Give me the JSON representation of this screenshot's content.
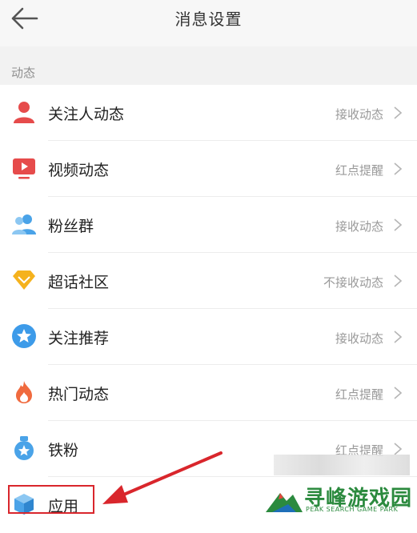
{
  "header": {
    "title": "消息设置",
    "back_icon": "back-arrow-icon"
  },
  "section": {
    "label": "动态"
  },
  "items": [
    {
      "label": "关注人动态",
      "value": "接收动态",
      "icon": "person-icon",
      "color": "#e64b4b"
    },
    {
      "label": "视频动态",
      "value": "红点提醒",
      "icon": "video-icon",
      "color": "#e64b4b"
    },
    {
      "label": "粉丝群",
      "value": "接收动态",
      "icon": "fans-group-icon",
      "color": "#4aa3e8"
    },
    {
      "label": "超话社区",
      "value": "不接收动态",
      "icon": "diamond-icon",
      "color": "#f5b21d"
    },
    {
      "label": "关注推荐",
      "value": "接收动态",
      "icon": "star-badge-icon",
      "color": "#3d9be9"
    },
    {
      "label": "热门动态",
      "value": "红点提醒",
      "icon": "flame-icon",
      "color": "#f06a3e"
    },
    {
      "label": "铁粉",
      "value": "红点提醒",
      "icon": "medal-icon",
      "color": "#4aa3e8"
    },
    {
      "label": "应用",
      "value": "",
      "icon": "cube-icon",
      "color": "#4aa3e8"
    }
  ],
  "annotation": {
    "highlight_color": "#d9262c"
  },
  "watermark": {
    "name": "寻峰游戏园",
    "subtitle": "PEAK SEARCH GAME PARK",
    "color": "#2b8a3e"
  }
}
